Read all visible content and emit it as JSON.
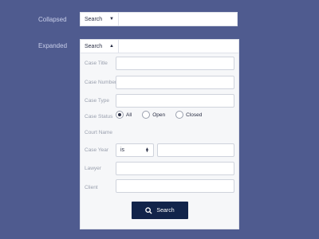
{
  "collapsed": {
    "label": "Collapsed",
    "dropdown": "Search"
  },
  "expanded": {
    "label": "Expanded",
    "dropdown": "Search",
    "fields": {
      "case_title": "Case Title",
      "case_number": "Case Number",
      "case_type": "Case Type",
      "case_status": "Case Status",
      "court_name": "Court Name",
      "case_year": "Case Year",
      "lawyer": "Lawyer",
      "client": "Client"
    },
    "status_options": {
      "all": "All",
      "open": "Open",
      "closed": "Closed"
    },
    "status_selected": "All",
    "year_operator": "is",
    "search_button": "Search"
  },
  "icons": {
    "search": "search-icon",
    "dropdown": "caret-icon"
  },
  "colors": {
    "background": "#4f5b8f",
    "button": "#12244a",
    "panel": "#f6f7f9"
  }
}
